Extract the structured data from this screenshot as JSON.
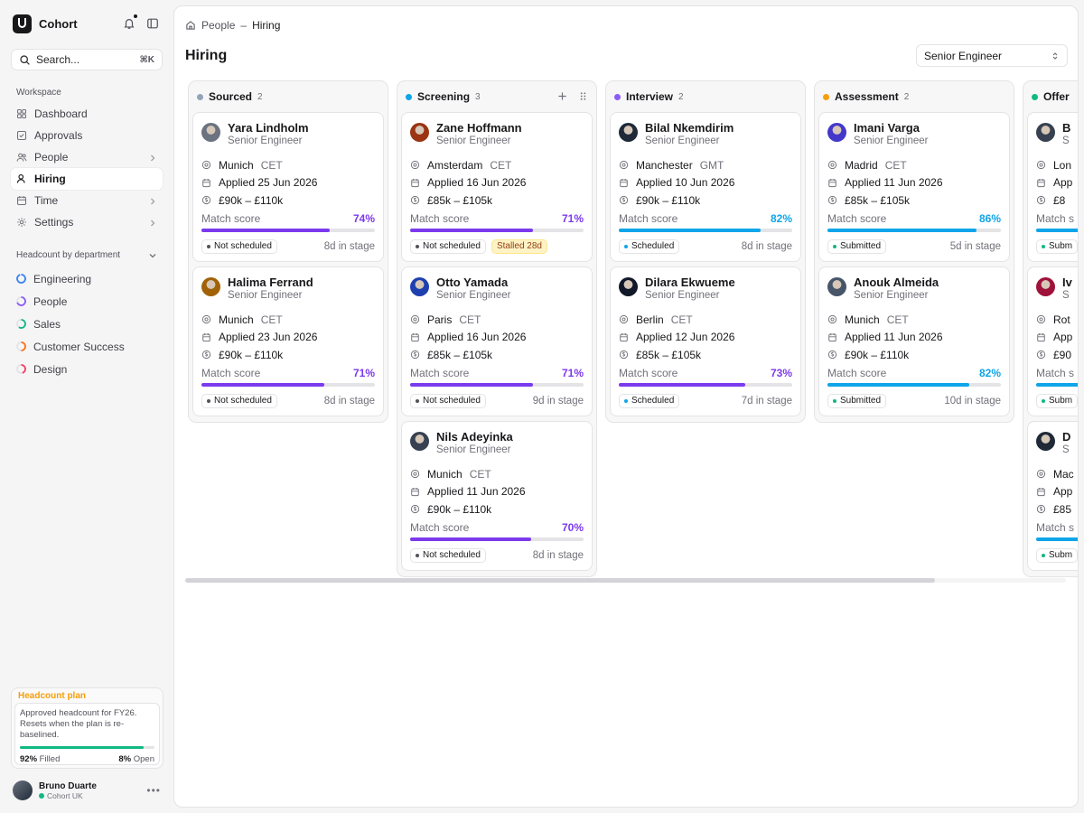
{
  "app": {
    "name": "Cohort"
  },
  "search": {
    "placeholder": "Search...",
    "shortcut": "⌘K"
  },
  "workspace_label": "Workspace",
  "nav": [
    {
      "label": "Dashboard",
      "icon": "dashboard-icon",
      "active": false,
      "chevron": false
    },
    {
      "label": "Approvals",
      "icon": "check-square-icon",
      "active": false,
      "chevron": false
    },
    {
      "label": "People",
      "icon": "people-icon",
      "active": false,
      "chevron": true
    },
    {
      "label": "Hiring",
      "icon": "user-icon",
      "active": true,
      "chevron": false
    },
    {
      "label": "Time",
      "icon": "calendar-icon",
      "active": false,
      "chevron": true
    },
    {
      "label": "Settings",
      "icon": "gear-icon",
      "active": false,
      "chevron": true
    }
  ],
  "headcount": {
    "label": "Headcount by department",
    "departments": [
      {
        "name": "Engineering",
        "color": "#3b82f6",
        "fill": 0.95
      },
      {
        "name": "People",
        "color": "#8b5cf6",
        "fill": 0.7
      },
      {
        "name": "Sales",
        "color": "#10b981",
        "fill": 0.6
      },
      {
        "name": "Customer Success",
        "color": "#f97316",
        "fill": 0.5
      },
      {
        "name": "Design",
        "color": "#f43f5e",
        "fill": 0.45
      }
    ]
  },
  "plan": {
    "title": "Headcount plan",
    "description": "Approved headcount for FY26. Resets when the plan is re-baselined.",
    "filled_pct": "92%",
    "filled_label": "Filled",
    "open_pct": "8%",
    "open_label": "Open",
    "filled_fraction": 0.92
  },
  "user": {
    "name": "Bruno Duarte",
    "org": "Cohort UK"
  },
  "breadcrumb": {
    "parent": "People",
    "separator": "–",
    "current": "Hiring"
  },
  "page": {
    "title": "Hiring",
    "role_filter": "Senior Engineer"
  },
  "colors": {
    "purple": "#7c3aed",
    "blue": "#0ea5e9"
  },
  "columns": [
    {
      "title": "Sourced",
      "count": "2",
      "dot": "#94a3b8",
      "actions": false,
      "cards": [
        {
          "name": "Yara Lindholm",
          "role": "Senior Engineer",
          "city": "Munich",
          "tz": "CET",
          "applied": "Applied 25 Jun 2026",
          "salary": "£90k – £110k",
          "score_label": "Match score",
          "score": "74%",
          "fraction": 0.74,
          "tone": "purple",
          "status": "Not scheduled",
          "status_dot": "#52525b",
          "stalled": "",
          "stage": "8d in stage",
          "av": "#6b7280"
        },
        {
          "name": "Halima Ferrand",
          "role": "Senior Engineer",
          "city": "Munich",
          "tz": "CET",
          "applied": "Applied 23 Jun 2026",
          "salary": "£90k – £110k",
          "score_label": "Match score",
          "score": "71%",
          "fraction": 0.71,
          "tone": "purple",
          "status": "Not scheduled",
          "status_dot": "#52525b",
          "stalled": "",
          "stage": "8d in stage",
          "av": "#a16207"
        }
      ]
    },
    {
      "title": "Screening",
      "count": "3",
      "dot": "#0ea5e9",
      "actions": true,
      "cards": [
        {
          "name": "Zane Hoffmann",
          "role": "Senior Engineer",
          "city": "Amsterdam",
          "tz": "CET",
          "applied": "Applied 16 Jun 2026",
          "salary": "£85k – £105k",
          "score_label": "Match score",
          "score": "71%",
          "fraction": 0.71,
          "tone": "purple",
          "status": "Not scheduled",
          "status_dot": "#52525b",
          "stalled": "Stalled 28d",
          "stage": "",
          "av": "#9a3412"
        },
        {
          "name": "Otto Yamada",
          "role": "Senior Engineer",
          "city": "Paris",
          "tz": "CET",
          "applied": "Applied 16 Jun 2026",
          "salary": "£85k – £105k",
          "score_label": "Match score",
          "score": "71%",
          "fraction": 0.71,
          "tone": "purple",
          "status": "Not scheduled",
          "status_dot": "#52525b",
          "stalled": "",
          "stage": "9d in stage",
          "av": "#1e40af"
        },
        {
          "name": "Nils Adeyinka",
          "role": "Senior Engineer",
          "city": "Munich",
          "tz": "CET",
          "applied": "Applied 11 Jun 2026",
          "salary": "£90k – £110k",
          "score_label": "Match score",
          "score": "70%",
          "fraction": 0.7,
          "tone": "purple",
          "status": "Not scheduled",
          "status_dot": "#52525b",
          "stalled": "",
          "stage": "8d in stage",
          "av": "#374151"
        }
      ]
    },
    {
      "title": "Interview",
      "count": "2",
      "dot": "#8b5cf6",
      "actions": false,
      "cards": [
        {
          "name": "Bilal Nkemdirim",
          "role": "Senior Engineer",
          "city": "Manchester",
          "tz": "GMT",
          "applied": "Applied 10 Jun 2026",
          "salary": "£90k – £110k",
          "score_label": "Match score",
          "score": "82%",
          "fraction": 0.82,
          "tone": "blue",
          "status": "Scheduled",
          "status_dot": "#0ea5e9",
          "stalled": "",
          "stage": "8d in stage",
          "av": "#1f2937"
        },
        {
          "name": "Dilara Ekwueme",
          "role": "Senior Engineer",
          "city": "Berlin",
          "tz": "CET",
          "applied": "Applied 12 Jun 2026",
          "salary": "£85k – £105k",
          "score_label": "Match score",
          "score": "73%",
          "fraction": 0.73,
          "tone": "purple",
          "status": "Scheduled",
          "status_dot": "#0ea5e9",
          "stalled": "",
          "stage": "7d in stage",
          "av": "#111827"
        }
      ]
    },
    {
      "title": "Assessment",
      "count": "2",
      "dot": "#f59e0b",
      "actions": false,
      "cards": [
        {
          "name": "Imani Varga",
          "role": "Senior Engineer",
          "city": "Madrid",
          "tz": "CET",
          "applied": "Applied 11 Jun 2026",
          "salary": "£85k – £105k",
          "score_label": "Match score",
          "score": "86%",
          "fraction": 0.86,
          "tone": "blue",
          "status": "Submitted",
          "status_dot": "#10b981",
          "stalled": "",
          "stage": "5d in stage",
          "av": "#4338ca"
        },
        {
          "name": "Anouk Almeida",
          "role": "Senior Engineer",
          "city": "Munich",
          "tz": "CET",
          "applied": "Applied 11 Jun 2026",
          "salary": "£90k – £110k",
          "score_label": "Match score",
          "score": "82%",
          "fraction": 0.82,
          "tone": "blue",
          "status": "Submitted",
          "status_dot": "#10b981",
          "stalled": "",
          "stage": "10d in stage",
          "av": "#475569"
        }
      ]
    },
    {
      "title": "Offer",
      "count": "",
      "dot": "#10b981",
      "actions": false,
      "cards": [
        {
          "name": "B",
          "role": "S",
          "city": "Lon",
          "tz": "",
          "applied": "App",
          "salary": "£8",
          "score_label": "Match s",
          "score": "",
          "fraction": 0.9,
          "tone": "blue",
          "status": "Subm",
          "status_dot": "#10b981",
          "stalled": "",
          "stage": "",
          "av": "#374151"
        },
        {
          "name": "Iv",
          "role": "S",
          "city": "Rot",
          "tz": "",
          "applied": "App",
          "salary": "£90",
          "score_label": "Match s",
          "score": "",
          "fraction": 0.9,
          "tone": "blue",
          "status": "Subm",
          "status_dot": "#10b981",
          "stalled": "",
          "stage": "",
          "av": "#9f1239"
        },
        {
          "name": "D",
          "role": "S",
          "city": "Mac",
          "tz": "",
          "applied": "App",
          "salary": "£85",
          "score_label": "Match s",
          "score": "",
          "fraction": 0.9,
          "tone": "blue",
          "status": "Subm",
          "status_dot": "#10b981",
          "stalled": "",
          "stage": "",
          "av": "#1f2937"
        }
      ]
    }
  ]
}
